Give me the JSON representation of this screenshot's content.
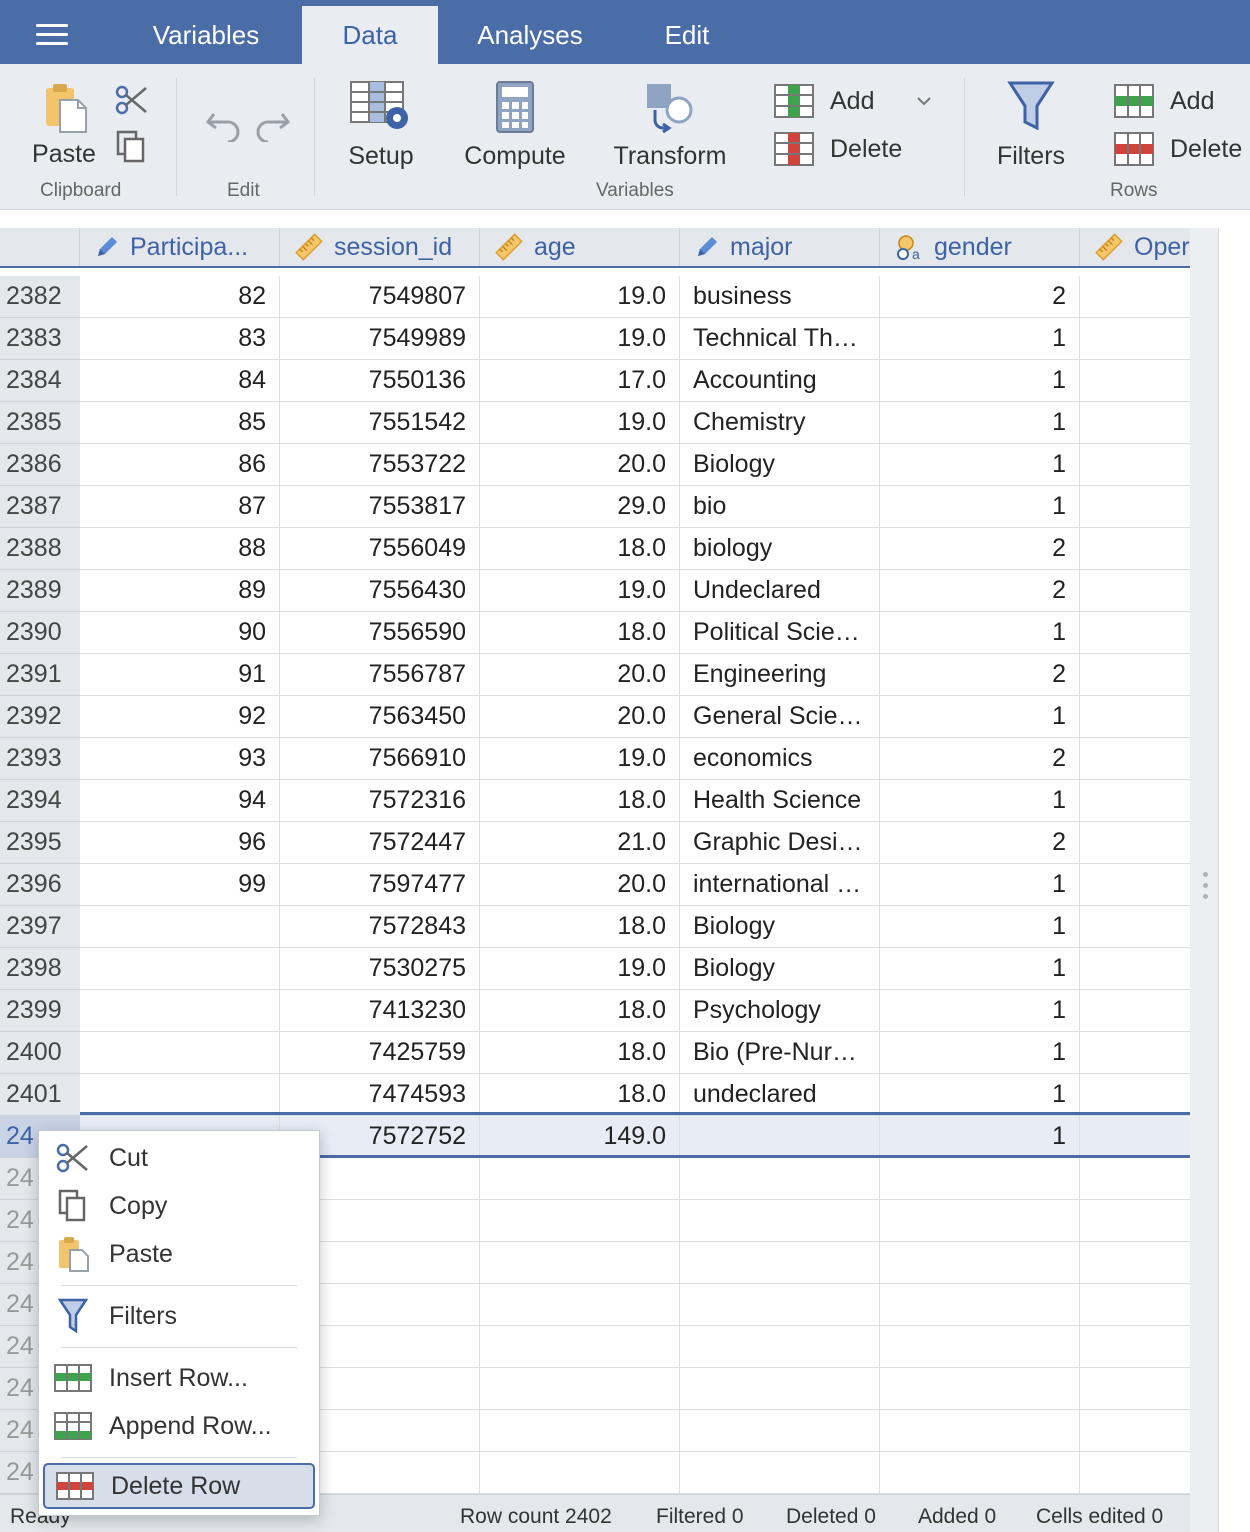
{
  "menubar": {
    "tabs": [
      "Variables",
      "Data",
      "Analyses",
      "Edit"
    ],
    "active_tab": "Data"
  },
  "ribbon": {
    "clipboard": {
      "paste": "Paste",
      "group": "Clipboard"
    },
    "edit": {
      "group": "Edit"
    },
    "variables": {
      "setup": "Setup",
      "compute": "Compute",
      "transform": "Transform",
      "add": "Add",
      "delete": "Delete",
      "group": "Variables"
    },
    "filters": {
      "label": "Filters"
    },
    "rows": {
      "add": "Add",
      "delete": "Delete",
      "group": "Rows"
    }
  },
  "grid": {
    "columns": [
      {
        "label": "Participa...",
        "icon": "nominal-pencil-icon"
      },
      {
        "label": "session_id",
        "icon": "ruler-icon"
      },
      {
        "label": "age",
        "icon": "ruler-icon"
      },
      {
        "label": "major",
        "icon": "nominal-pencil-icon"
      },
      {
        "label": "gender",
        "icon": "nominal-text-icon"
      },
      {
        "label": "Oper",
        "icon": "ruler-icon"
      }
    ],
    "rows": [
      {
        "n": "2382",
        "p": "82",
        "s": "7549807",
        "a": "19.0",
        "m": "business",
        "g": "2"
      },
      {
        "n": "2383",
        "p": "83",
        "s": "7549989",
        "a": "19.0",
        "m": "Technical Th…",
        "g": "1"
      },
      {
        "n": "2384",
        "p": "84",
        "s": "7550136",
        "a": "17.0",
        "m": "Accounting",
        "g": "1"
      },
      {
        "n": "2385",
        "p": "85",
        "s": "7551542",
        "a": "19.0",
        "m": "Chemistry",
        "g": "1"
      },
      {
        "n": "2386",
        "p": "86",
        "s": "7553722",
        "a": "20.0",
        "m": "Biology",
        "g": "1"
      },
      {
        "n": "2387",
        "p": "87",
        "s": "7553817",
        "a": "29.0",
        "m": "bio",
        "g": "1"
      },
      {
        "n": "2388",
        "p": "88",
        "s": "7556049",
        "a": "18.0",
        "m": "biology",
        "g": "2"
      },
      {
        "n": "2389",
        "p": "89",
        "s": "7556430",
        "a": "19.0",
        "m": "Undeclared",
        "g": "2"
      },
      {
        "n": "2390",
        "p": "90",
        "s": "7556590",
        "a": "18.0",
        "m": "Political Scie…",
        "g": "1"
      },
      {
        "n": "2391",
        "p": "91",
        "s": "7556787",
        "a": "20.0",
        "m": "Engineering",
        "g": "2"
      },
      {
        "n": "2392",
        "p": "92",
        "s": "7563450",
        "a": "20.0",
        "m": "General Scie…",
        "g": "1"
      },
      {
        "n": "2393",
        "p": "93",
        "s": "7566910",
        "a": "19.0",
        "m": "economics",
        "g": "2"
      },
      {
        "n": "2394",
        "p": "94",
        "s": "7572316",
        "a": "18.0",
        "m": "Health Science",
        "g": "1"
      },
      {
        "n": "2395",
        "p": "96",
        "s": "7572447",
        "a": "21.0",
        "m": "Graphic Desi…",
        "g": "2"
      },
      {
        "n": "2396",
        "p": "99",
        "s": "7597477",
        "a": "20.0",
        "m": "international …",
        "g": "1"
      },
      {
        "n": "2397",
        "p": "",
        "s": "7572843",
        "a": "18.0",
        "m": "Biology",
        "g": "1"
      },
      {
        "n": "2398",
        "p": "",
        "s": "7530275",
        "a": "19.0",
        "m": "Biology",
        "g": "1"
      },
      {
        "n": "2399",
        "p": "",
        "s": "7413230",
        "a": "18.0",
        "m": "Psychology",
        "g": "1"
      },
      {
        "n": "2400",
        "p": "",
        "s": "7425759",
        "a": "18.0",
        "m": "Bio (Pre-Nur…",
        "g": "1"
      },
      {
        "n": "2401",
        "p": "",
        "s": "7474593",
        "a": "18.0",
        "m": "undeclared",
        "g": "1"
      },
      {
        "n": "24",
        "p": "",
        "s": "7572752",
        "a": "149.0",
        "m": "",
        "g": "1",
        "selected": true
      },
      {
        "n": "24",
        "p": "",
        "s": "",
        "a": "",
        "m": "",
        "g": ""
      },
      {
        "n": "24",
        "p": "",
        "s": "",
        "a": "",
        "m": "",
        "g": ""
      },
      {
        "n": "24",
        "p": "",
        "s": "",
        "a": "",
        "m": "",
        "g": ""
      },
      {
        "n": "24",
        "p": "",
        "s": "",
        "a": "",
        "m": "",
        "g": ""
      },
      {
        "n": "24",
        "p": "",
        "s": "",
        "a": "",
        "m": "",
        "g": ""
      },
      {
        "n": "24",
        "p": "",
        "s": "",
        "a": "",
        "m": "",
        "g": ""
      },
      {
        "n": "24",
        "p": "",
        "s": "",
        "a": "",
        "m": "",
        "g": ""
      },
      {
        "n": "24",
        "p": "",
        "s": "",
        "a": "",
        "m": "",
        "g": ""
      }
    ]
  },
  "statusbar": {
    "ready": "Ready",
    "row_count": "Row count 2402",
    "filtered": "Filtered 0",
    "deleted": "Deleted 0",
    "added": "Added 0",
    "cells_edited": "Cells edited 0"
  },
  "context_menu": {
    "cut": "Cut",
    "copy": "Copy",
    "paste": "Paste",
    "filters": "Filters",
    "insert_row": "Insert Row...",
    "append_row": "Append Row...",
    "delete_row": "Delete Row",
    "highlighted": "Delete Row"
  },
  "colors": {
    "accent": "#4a6da7",
    "ribbon_bg": "#e9ecf1",
    "ruler": "#f0a830",
    "add_green": "#3fa34d",
    "delete_red": "#d0443c"
  }
}
